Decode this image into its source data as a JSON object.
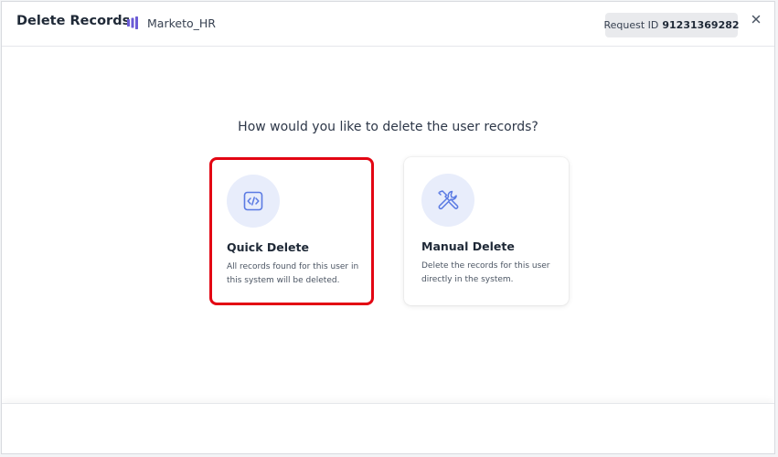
{
  "header": {
    "title": "Delete Records",
    "system_icon": "system-logo-icon",
    "system_name": "Marketo_HR",
    "request_id_label": "Request ID",
    "request_id_value": "91231369282",
    "close_label": "×"
  },
  "main": {
    "question": "How would you like to delete the user records?",
    "options": [
      {
        "icon": "code-icon",
        "title": "Quick Delete",
        "description": "All records found for this user in this system will be deleted.",
        "selected": true
      },
      {
        "icon": "tools-icon",
        "title": "Manual Delete",
        "description": "Delete the records for this user directly in the system.",
        "selected": false
      }
    ]
  },
  "colors": {
    "accent": "#6b5bd6",
    "icon_blue": "#5b7be3",
    "icon_bg": "#e8edfb",
    "highlight_border": "#e30613"
  }
}
